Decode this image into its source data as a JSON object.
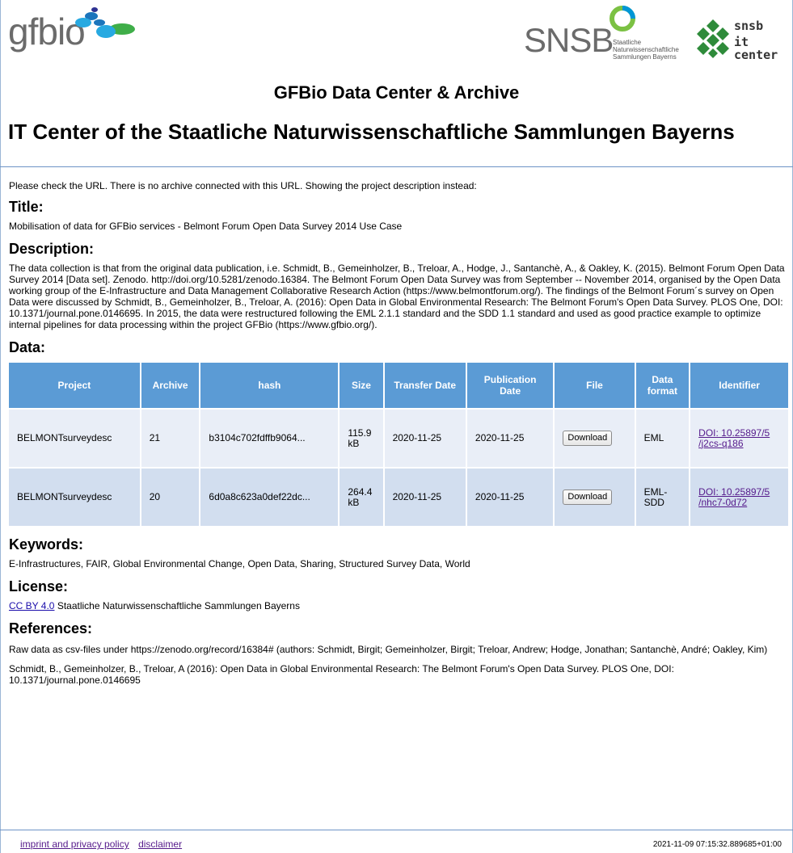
{
  "logos": {
    "gfbio_text": "gfbio",
    "snsb_text": "SNSB",
    "snsb_subtitle_lines": [
      "Staatliche",
      "Naturwissenschaftliche",
      "Sammlungen Bayerns"
    ],
    "itcenter_line1": "snsb",
    "itcenter_line2": "it center"
  },
  "page": {
    "title": "GFBio Data Center & Archive",
    "subtitle": "IT Center of the Staatliche Naturwissenschaftliche Sammlungen Bayerns"
  },
  "notice": "Please check the URL. There is no archive connected with this URL. Showing the project description instead:",
  "sections": {
    "title_heading": "Title:",
    "title_text": "Mobilisation of data for GFBio services - Belmont Forum Open Data Survey 2014 Use Case",
    "description_heading": "Description:",
    "description_text": "The data collection is that from the original data publication, i.e. Schmidt, B., Gemeinholzer, B., Treloar, A., Hodge, J., Santanchè, A., & Oakley, K. (2015). Belmont Forum Open Data Survey 2014 [Data set]. Zenodo. http://doi.org/10.5281/zenodo.16384. The Belmont Forum Open Data Survey was from September -- November 2014, organised by the Open Data working group of the E-Infrastructure and Data Management Collaborative Research Action (https://www.belmontforum.org/). The findings of the Belmont Forum´s survey on Open Data were discussed by Schmidt, B., Gemeinholzer, B., Treloar, A. (2016): Open Data in Global Environmental Research: The Belmont Forum's Open Data Survey. PLOS One, DOI: 10.1371/journal.pone.0146695. In 2015, the data were restructured following the EML 2.1.1 standard and the SDD 1.1 standard and used as good practice example to optimize internal pipelines for data processing within the project GFBio (https://www.gfbio.org/).",
    "data_heading": "Data:",
    "keywords_heading": "Keywords:",
    "keywords_text": "E-Infrastructures, FAIR, Global Environmental Change, Open Data, Sharing, Structured Survey Data, World",
    "license_heading": "License:",
    "license_link": "CC BY 4.0",
    "license_holder": "Staatliche Naturwissenschaftliche Sammlungen Bayerns",
    "references_heading": "References:",
    "reference_1": "Raw data as csv-files under https://zenodo.org/record/16384# (authors: Schmidt, Birgit; Gemeinholzer, Birgit; Treloar, Andrew; Hodge, Jonathan; Santanchè, André; Oakley, Kim)",
    "reference_2": "Schmidt, B., Gemeinholzer, B., Treloar, A (2016): Open Data in Global Environmental Research: The Belmont Forum's Open Data Survey. PLOS One, DOI: 10.1371/journal.pone.0146695"
  },
  "table": {
    "headers": [
      "Project",
      "Archive",
      "hash",
      "Size",
      "Transfer Date",
      "Publication Date",
      "File",
      "Data format",
      "Identifier"
    ],
    "rows": [
      {
        "project": "BELMONTsurveydesc",
        "archive": "21",
        "hash": "b3104c702fdffb9064...",
        "size": "115.9 kB",
        "transfer_date": "2020-11-25",
        "publication_date": "2020-11-25",
        "file_button": "Download",
        "data_format": "EML",
        "identifier": "DOI: 10.25897/5 /j2cs-q186"
      },
      {
        "project": "BELMONTsurveydesc",
        "archive": "20",
        "hash": "6d0a8c623a0def22dc...",
        "size": "264.4 kB",
        "transfer_date": "2020-11-25",
        "publication_date": "2020-11-25",
        "file_button": "Download",
        "data_format": "EML- SDD",
        "identifier": "DOI: 10.25897/5 /nhc7-0d72"
      }
    ]
  },
  "footer": {
    "imprint_link": "imprint and privacy policy",
    "disclaimer_link": "disclaimer",
    "timestamp": "2021-11-09 07:15:32.889685+01:00"
  },
  "colors": {
    "table_header": "#5b9bd5",
    "row_odd": "#e9eef7",
    "row_even": "#d2deef",
    "rule": "#6d93c6",
    "link": "#551a8b"
  }
}
